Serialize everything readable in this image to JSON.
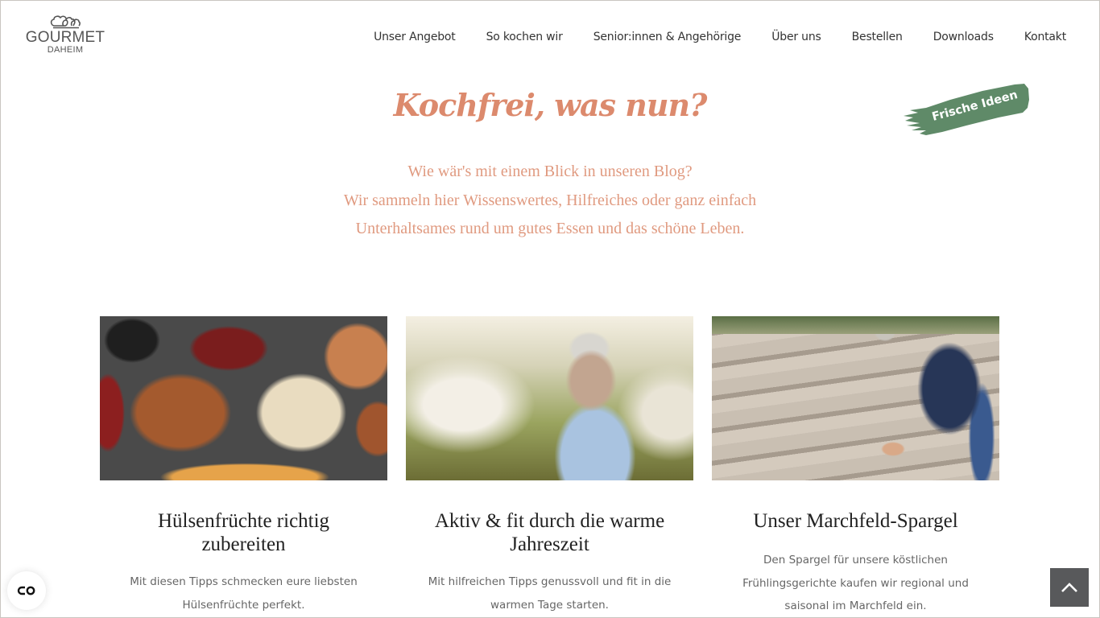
{
  "header": {
    "logo": {
      "brand": "GOURMET",
      "sub": "DAHEIM",
      "icon": "chef-hats-icon"
    },
    "nav": [
      {
        "label": "Unser Angebot"
      },
      {
        "label": "So kochen wir"
      },
      {
        "label": "Senior:innen & Angehörige"
      },
      {
        "label": "Über uns"
      },
      {
        "label": "Bestellen"
      },
      {
        "label": "Downloads"
      },
      {
        "label": "Kontakt"
      }
    ]
  },
  "hero": {
    "title": "Kochfrei, was nun?",
    "badge": "Frische Ideen",
    "intro": [
      "Wie wär's mit einem Blick in unseren Blog?",
      "Wir sammeln hier Wissenswertes, Hilfreiches oder ganz einfach",
      "Unterhaltsames rund um gutes Essen und das schöne Leben."
    ]
  },
  "cards": [
    {
      "image": "assorted-legumes-photo",
      "title": "Hülsenfrüchte richtig zubereiten",
      "text": "Mit diesen Tipps schmecken eure liebsten Hülsenfrüchte perfekt."
    },
    {
      "image": "senior-woman-blossoming-orchard-photo",
      "title": "Aktiv & fit durch die warme Jahreszeit",
      "text": "Mit hilfreichen Tipps genussvoll und fit in die warmen Tage starten."
    },
    {
      "image": "man-harvesting-asparagus-photo",
      "title": "Unser Marchfeld-Spargel",
      "text": "Den Spargel für unsere köstlichen Frühlingsgerichte kaufen wir regional und saisonal im Marchfeld ein."
    }
  ],
  "floating": {
    "accessibility_icon": "accessibility-toggle-icon",
    "back_to_top_icon": "chevron-up-icon"
  },
  "colors": {
    "accent": "#dc8a6d",
    "intro_text": "#e09a80",
    "badge": "#5f8a68",
    "back_to_top": "#58595b"
  }
}
